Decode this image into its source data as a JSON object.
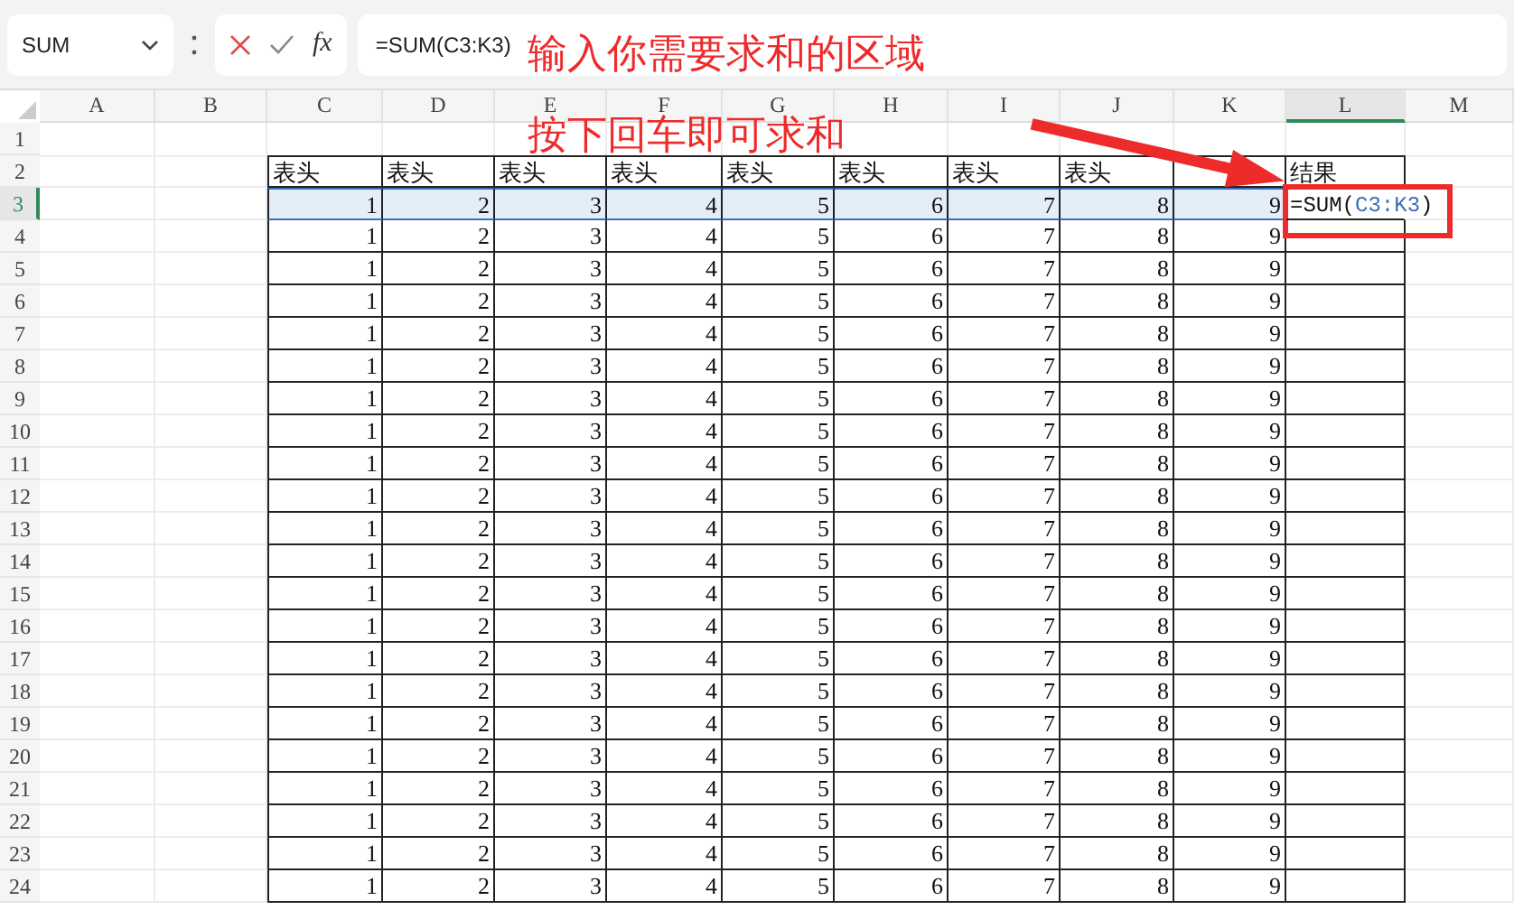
{
  "formula_bar": {
    "name_box": "SUM",
    "function_label": "fx",
    "value": "=SUM(C3:K3)"
  },
  "columns": [
    {
      "label": "A",
      "selected": false
    },
    {
      "label": "B",
      "selected": false
    },
    {
      "label": "C",
      "selected": false
    },
    {
      "label": "D",
      "selected": false
    },
    {
      "label": "E",
      "selected": false
    },
    {
      "label": "F",
      "selected": false
    },
    {
      "label": "G",
      "selected": false
    },
    {
      "label": "H",
      "selected": false
    },
    {
      "label": "I",
      "selected": false
    },
    {
      "label": "J",
      "selected": false
    },
    {
      "label": "K",
      "selected": false
    },
    {
      "label": "L",
      "selected": true
    },
    {
      "label": "M",
      "selected": false
    }
  ],
  "rows": [
    {
      "label": "1",
      "kind": "empty",
      "selected": false
    },
    {
      "label": "2",
      "kind": "header",
      "selected": false,
      "cells": [
        "表头",
        "表头",
        "表头",
        "表头",
        "表头",
        "表头",
        "表头",
        "表头",
        null,
        "结果"
      ]
    },
    {
      "label": "3",
      "kind": "number",
      "selected": true,
      "cells": [
        "1",
        "2",
        "3",
        "4",
        "5",
        "6",
        "7",
        "8",
        "9"
      ],
      "formula": {
        "prefix": "=SUM(",
        "ref": "C3:K3",
        "suffix": ")"
      }
    },
    {
      "label": "4",
      "kind": "number",
      "selected": false,
      "cells": [
        "1",
        "2",
        "3",
        "4",
        "5",
        "6",
        "7",
        "8",
        "9"
      ]
    },
    {
      "label": "5",
      "kind": "number",
      "selected": false,
      "cells": [
        "1",
        "2",
        "3",
        "4",
        "5",
        "6",
        "7",
        "8",
        "9"
      ]
    },
    {
      "label": "6",
      "kind": "number",
      "selected": false,
      "cells": [
        "1",
        "2",
        "3",
        "4",
        "5",
        "6",
        "7",
        "8",
        "9"
      ]
    },
    {
      "label": "7",
      "kind": "number",
      "selected": false,
      "cells": [
        "1",
        "2",
        "3",
        "4",
        "5",
        "6",
        "7",
        "8",
        "9"
      ]
    },
    {
      "label": "8",
      "kind": "number",
      "selected": false,
      "cells": [
        "1",
        "2",
        "3",
        "4",
        "5",
        "6",
        "7",
        "8",
        "9"
      ]
    },
    {
      "label": "9",
      "kind": "number",
      "selected": false,
      "cells": [
        "1",
        "2",
        "3",
        "4",
        "5",
        "6",
        "7",
        "8",
        "9"
      ]
    },
    {
      "label": "10",
      "kind": "number",
      "selected": false,
      "cells": [
        "1",
        "2",
        "3",
        "4",
        "5",
        "6",
        "7",
        "8",
        "9"
      ]
    },
    {
      "label": "11",
      "kind": "number",
      "selected": false,
      "cells": [
        "1",
        "2",
        "3",
        "4",
        "5",
        "6",
        "7",
        "8",
        "9"
      ]
    },
    {
      "label": "12",
      "kind": "number",
      "selected": false,
      "cells": [
        "1",
        "2",
        "3",
        "4",
        "5",
        "6",
        "7",
        "8",
        "9"
      ]
    },
    {
      "label": "13",
      "kind": "number",
      "selected": false,
      "cells": [
        "1",
        "2",
        "3",
        "4",
        "5",
        "6",
        "7",
        "8",
        "9"
      ]
    },
    {
      "label": "14",
      "kind": "number",
      "selected": false,
      "cells": [
        "1",
        "2",
        "3",
        "4",
        "5",
        "6",
        "7",
        "8",
        "9"
      ]
    },
    {
      "label": "15",
      "kind": "number",
      "selected": false,
      "cells": [
        "1",
        "2",
        "3",
        "4",
        "5",
        "6",
        "7",
        "8",
        "9"
      ]
    },
    {
      "label": "16",
      "kind": "number",
      "selected": false,
      "cells": [
        "1",
        "2",
        "3",
        "4",
        "5",
        "6",
        "7",
        "8",
        "9"
      ]
    },
    {
      "label": "17",
      "kind": "number",
      "selected": false,
      "cells": [
        "1",
        "2",
        "3",
        "4",
        "5",
        "6",
        "7",
        "8",
        "9"
      ]
    },
    {
      "label": "18",
      "kind": "number",
      "selected": false,
      "cells": [
        "1",
        "2",
        "3",
        "4",
        "5",
        "6",
        "7",
        "8",
        "9"
      ]
    },
    {
      "label": "19",
      "kind": "number",
      "selected": false,
      "cells": [
        "1",
        "2",
        "3",
        "4",
        "5",
        "6",
        "7",
        "8",
        "9"
      ]
    },
    {
      "label": "20",
      "kind": "number",
      "selected": false,
      "cells": [
        "1",
        "2",
        "3",
        "4",
        "5",
        "6",
        "7",
        "8",
        "9"
      ]
    },
    {
      "label": "21",
      "kind": "number",
      "selected": false,
      "cells": [
        "1",
        "2",
        "3",
        "4",
        "5",
        "6",
        "7",
        "8",
        "9"
      ]
    },
    {
      "label": "22",
      "kind": "number",
      "selected": false,
      "cells": [
        "1",
        "2",
        "3",
        "4",
        "5",
        "6",
        "7",
        "8",
        "9"
      ]
    },
    {
      "label": "23",
      "kind": "number",
      "selected": false,
      "cells": [
        "1",
        "2",
        "3",
        "4",
        "5",
        "6",
        "7",
        "8",
        "9"
      ]
    },
    {
      "label": "24",
      "kind": "number",
      "selected": false,
      "cells": [
        "1",
        "2",
        "3",
        "4",
        "5",
        "6",
        "7",
        "8",
        "9"
      ]
    }
  ],
  "annotation": {
    "lines": [
      "输入你需要求和的区域",
      "按下回车即可求和"
    ]
  }
}
